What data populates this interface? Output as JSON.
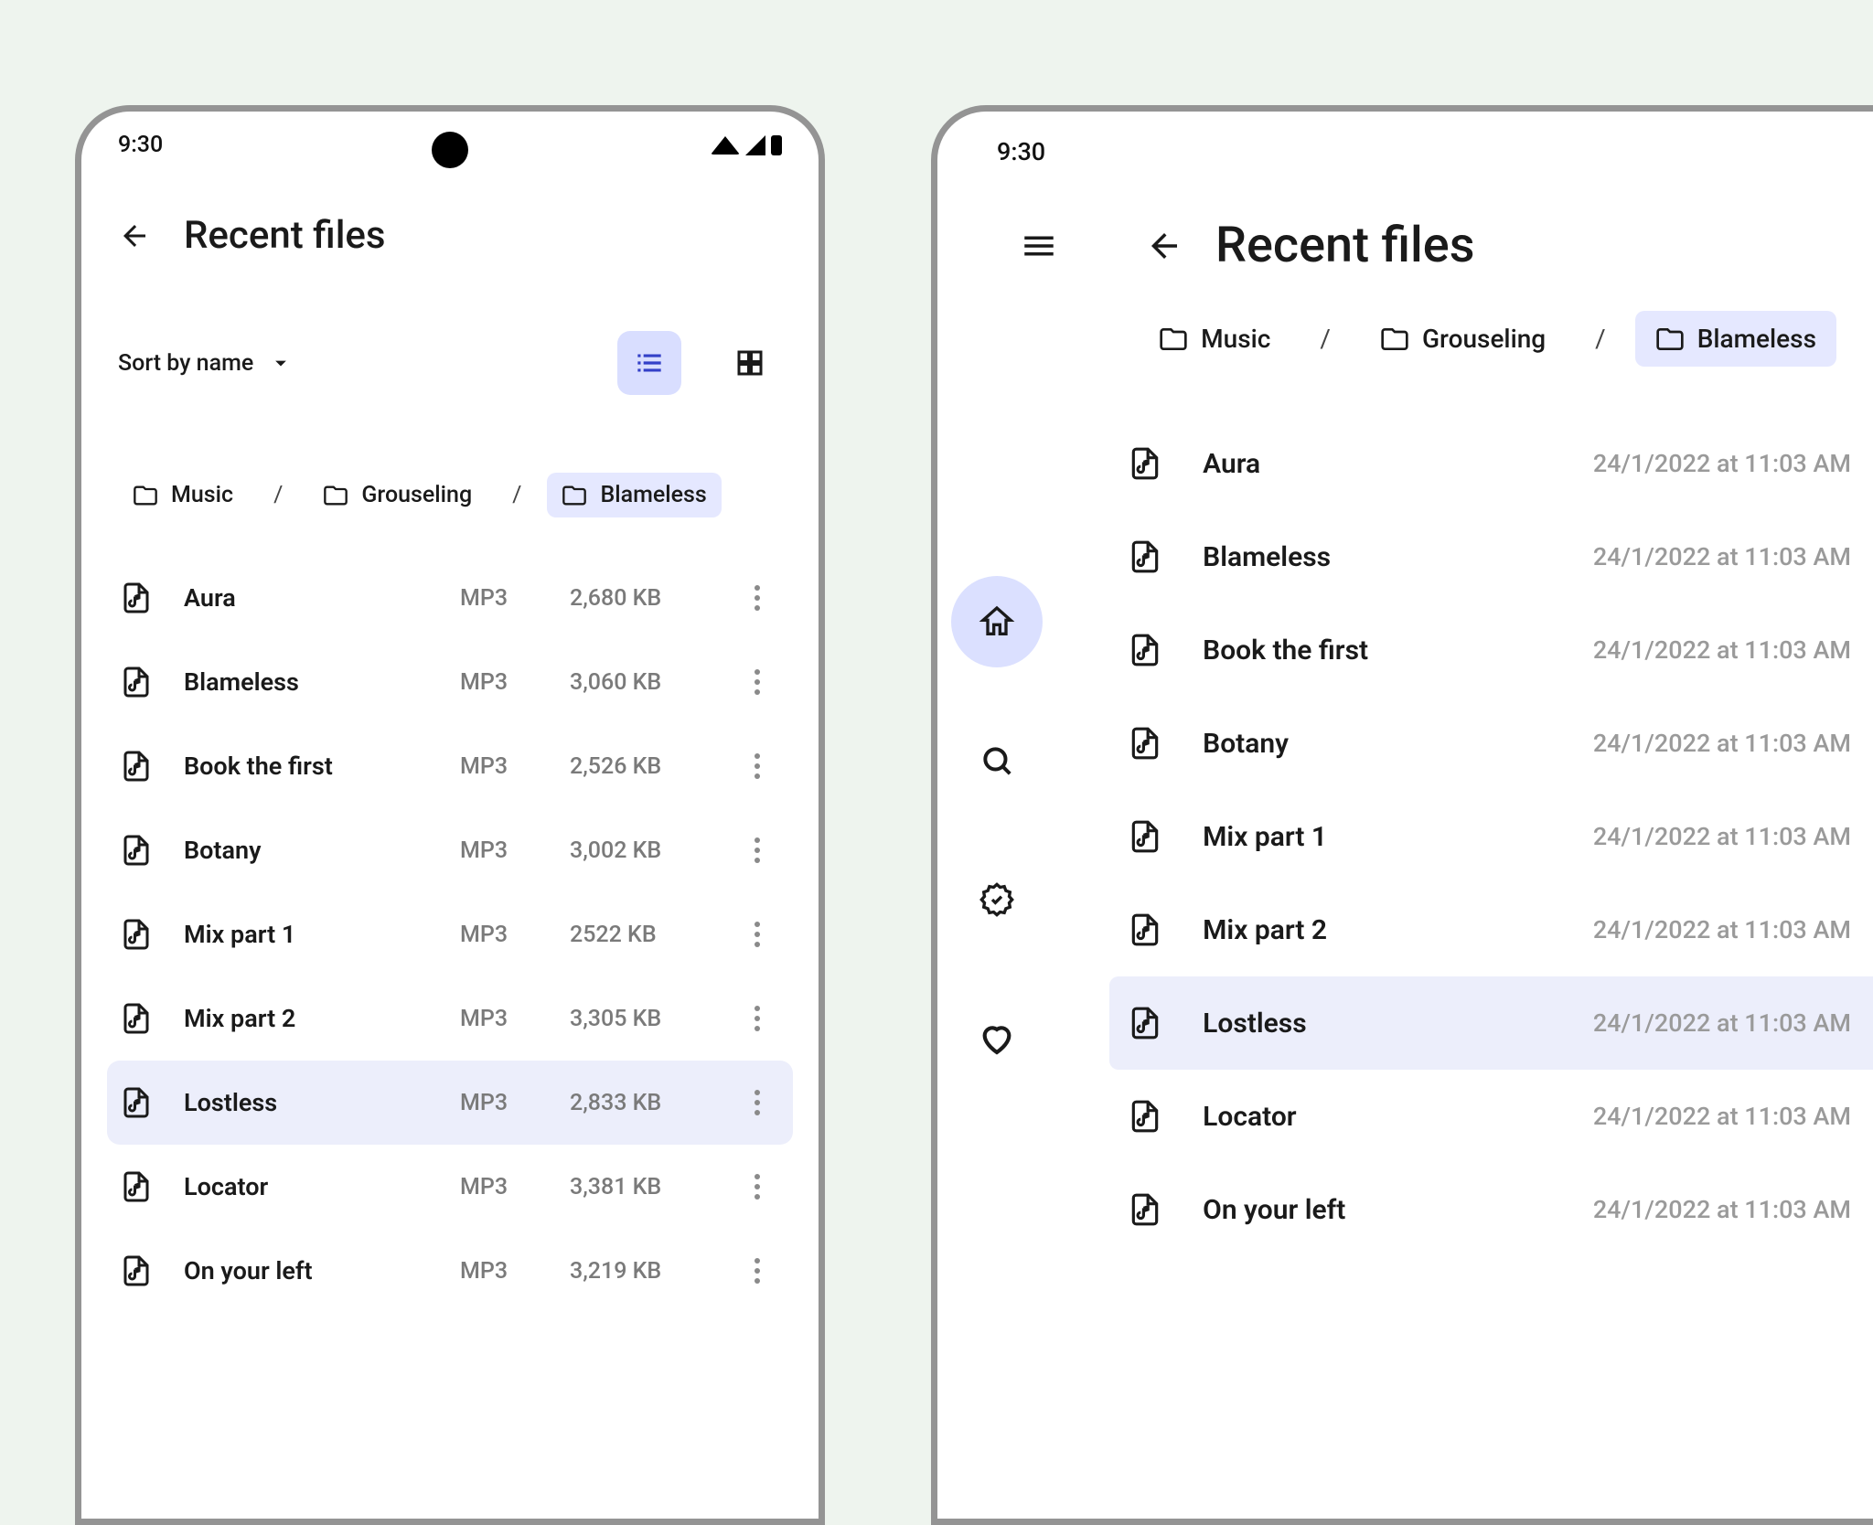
{
  "statusbar": {
    "time": "9:30"
  },
  "page": {
    "title": "Recent files"
  },
  "sort": {
    "label": "Sort by name"
  },
  "breadcrumbs": [
    {
      "label": "Music",
      "active": false
    },
    {
      "label": "Grouseling",
      "active": false
    },
    {
      "label": "Blameless",
      "active": true
    }
  ],
  "tablet_breadcrumbs": [
    {
      "label": "Music",
      "active": false
    },
    {
      "label": "Grouseling",
      "active": false
    },
    {
      "label": "Blameless",
      "active": true
    }
  ],
  "files": [
    {
      "name": "Aura",
      "type": "MP3",
      "size": "2,680 KB",
      "date": "24/1/2022 at 11:03 AM",
      "selected": false
    },
    {
      "name": "Blameless",
      "type": "MP3",
      "size": "3,060 KB",
      "date": "24/1/2022 at 11:03 AM",
      "selected": false
    },
    {
      "name": "Book the first",
      "type": "MP3",
      "size": "2,526 KB",
      "date": "24/1/2022 at 11:03 AM",
      "selected": false
    },
    {
      "name": "Botany",
      "type": "MP3",
      "size": "3,002 KB",
      "date": "24/1/2022 at 11:03 AM",
      "selected": false
    },
    {
      "name": "Mix part 1",
      "type": "MP3",
      "size": "2522 KB",
      "date": "24/1/2022 at 11:03 AM",
      "selected": false
    },
    {
      "name": "Mix part 2",
      "type": "MP3",
      "size": "3,305 KB",
      "date": "24/1/2022 at 11:03 AM",
      "selected": false
    },
    {
      "name": "Lostless",
      "type": "MP3",
      "size": "2,833 KB",
      "date": "24/1/2022 at 11:03 AM",
      "selected": true
    },
    {
      "name": "Locator",
      "type": "MP3",
      "size": "3,381 KB",
      "date": "24/1/2022 at 11:03 AM",
      "selected": false
    },
    {
      "name": "On your left",
      "type": "MP3",
      "size": "3,219 KB",
      "date": "24/1/2022 at 11:03 AM",
      "selected": false
    }
  ]
}
